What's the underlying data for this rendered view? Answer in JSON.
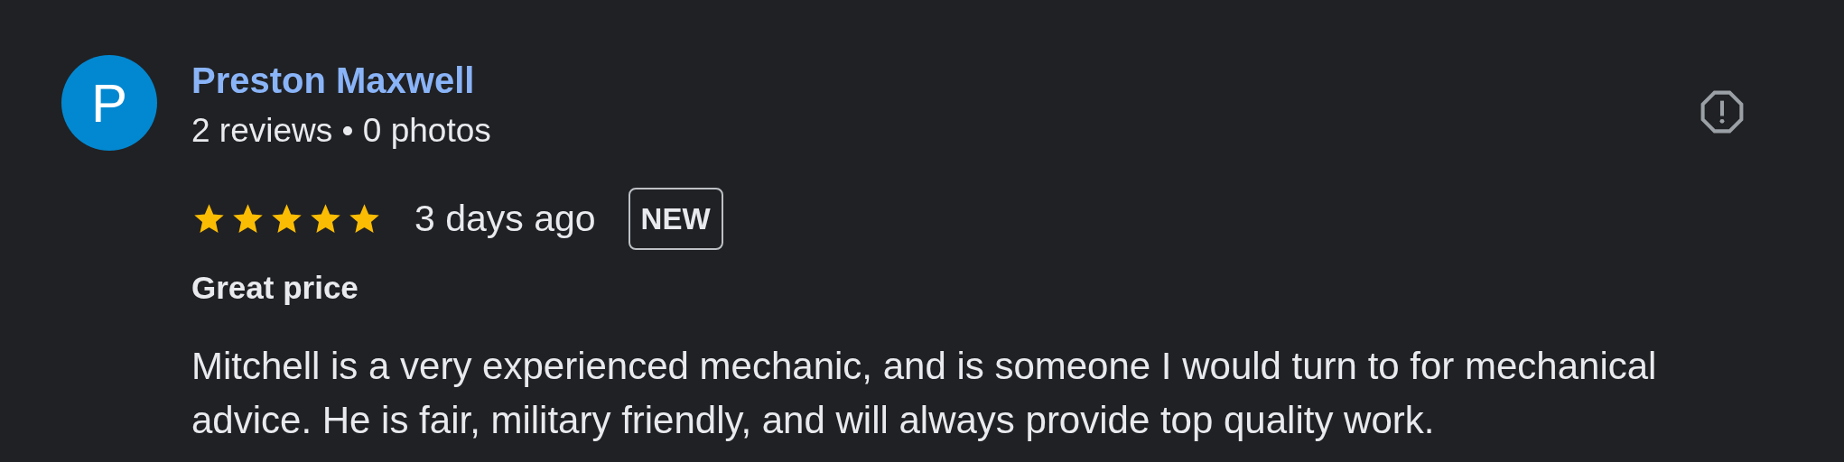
{
  "review": {
    "avatar_letter": "P",
    "reviewer_name": "Preston Maxwell",
    "reviewer_meta": "2 reviews • 0 photos",
    "stars": 5,
    "time": "3 days ago",
    "badge": "NEW",
    "title": "Great price",
    "body": "Mitchell is a very experienced mechanic, and is someone I would turn to for mechanical advice. He is fair, military friendly, and will always provide top quality work."
  }
}
